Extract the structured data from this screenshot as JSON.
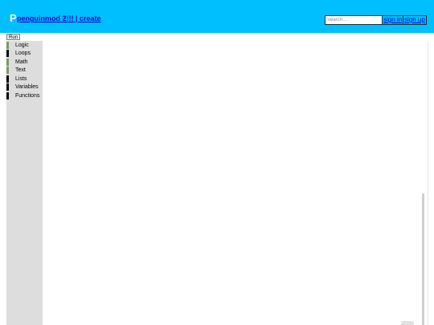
{
  "header": {
    "logo": "P",
    "title": "penguinmod 2!!! | create",
    "search": {
      "placeholder": "Search..."
    },
    "sign_in": "sign in",
    "sign_up": "sign up",
    "background": "#00bfff"
  },
  "toolbar": {
    "run_label": "Run"
  },
  "toolbox": {
    "categories": [
      {
        "label": "Logic",
        "color": "#7a9a5c"
      },
      {
        "label": "Loops",
        "color": "#000000"
      },
      {
        "label": "Math",
        "color": "#7a9a5c"
      },
      {
        "label": "Text",
        "color": "#7a9a5c"
      },
      {
        "label": "Lists",
        "color": "#000000"
      },
      {
        "label": "Variables",
        "color": "#000000"
      },
      {
        "label": "Functions",
        "color": "#000000"
      }
    ]
  }
}
